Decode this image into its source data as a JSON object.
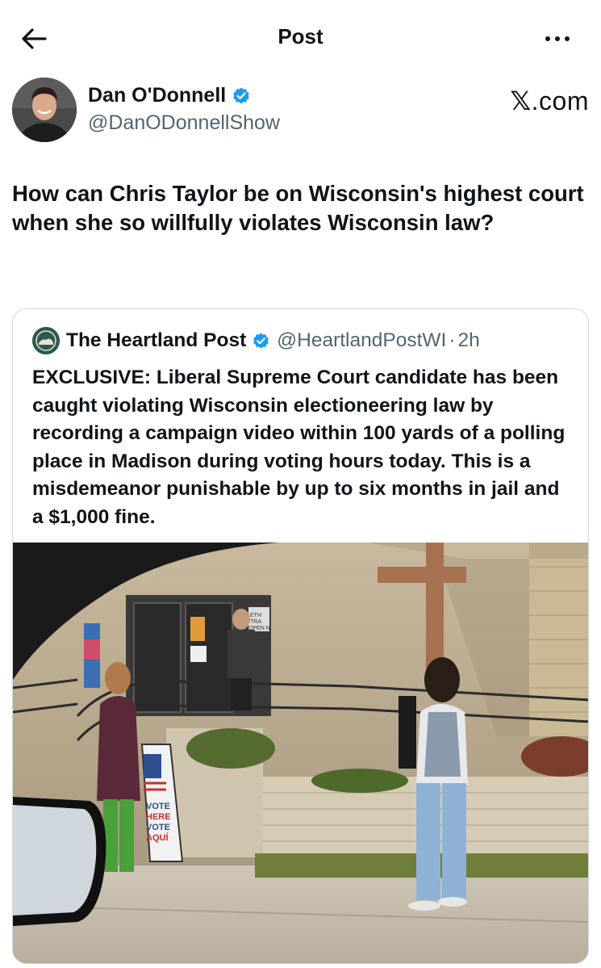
{
  "header": {
    "title": "Post",
    "back_icon": "arrow-left-icon",
    "more_icon": "more-horizontal-icon"
  },
  "author": {
    "name": "Dan O'Donnell",
    "handle": "@DanODonnellShow",
    "verified_color": "#1d9bf0"
  },
  "watermark": {
    "x_glyph": "𝕏",
    "suffix": ".com"
  },
  "post": {
    "text": "How can Chris Taylor be on Wisconsin's highest court when she so willfully violates Wisconsin law?"
  },
  "quoted_post": {
    "name": "The Heartland Post",
    "handle": "@HeartlandPostWI",
    "separator": "·",
    "time": "2h",
    "text": "EXCLUSIVE: Liberal Supreme Court candidate has been caught violating Wisconsin electioneering law by recording a campaign video within 100 yards of a polling place in Madison during voting hours today. This is a misdemeanor punishable by up to six months in jail and a $1,000 fine."
  },
  "photo": {
    "sign_text": [
      "VOTE",
      "HERE",
      "VOTE",
      "AQUÍ"
    ],
    "door_sign": [
      "ETH",
      "TRA",
      "OPEN N"
    ]
  },
  "colors": {
    "text": "#0f1419",
    "secondary": "#536471",
    "border": "#cfd9de",
    "verified": "#1d9bf0"
  }
}
